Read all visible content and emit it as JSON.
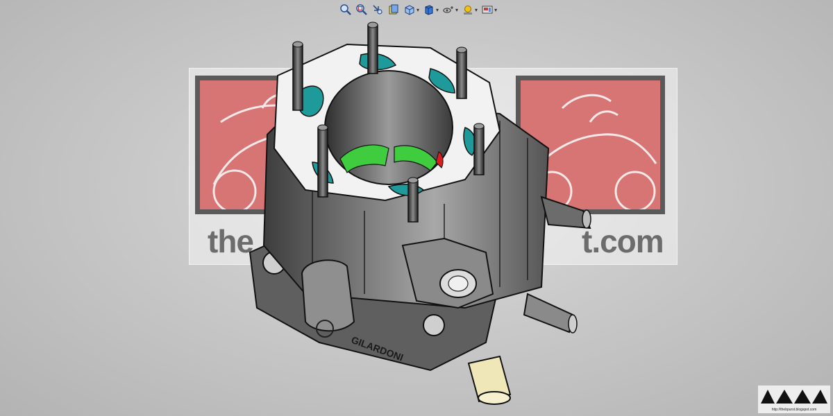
{
  "toolbar": {
    "items": [
      {
        "icon": "zoom-to-fit-icon",
        "has_menu": false
      },
      {
        "icon": "zoom-to-area-icon",
        "has_menu": false
      },
      {
        "icon": "previous-view-icon",
        "has_menu": false
      },
      {
        "icon": "section-view-icon",
        "has_menu": false
      },
      {
        "icon": "view-orientation-icon",
        "has_menu": true
      },
      {
        "icon": "display-style-icon",
        "has_menu": true
      },
      {
        "icon": "hide-show-items-icon",
        "has_menu": true
      },
      {
        "icon": "edit-appearance-icon",
        "has_menu": true
      },
      {
        "icon": "apply-scene-icon",
        "has_menu": true
      }
    ]
  },
  "watermark": {
    "left_text": "the",
    "right_text": "t.com"
  },
  "model": {
    "brand_engraving": "GILARDONI"
  },
  "corner_logo": {
    "url": "http://thebpurst.blogspot.com"
  },
  "colors": {
    "background": "#c9c9c9",
    "watermark_red": "#d77575",
    "part_body": "#6e6e6e",
    "gasket": "#f2f2f2",
    "ports_teal": "#1f9a9a",
    "transfer_green": "#3fcc3f",
    "inlet_pipe": "#efe7b8"
  }
}
